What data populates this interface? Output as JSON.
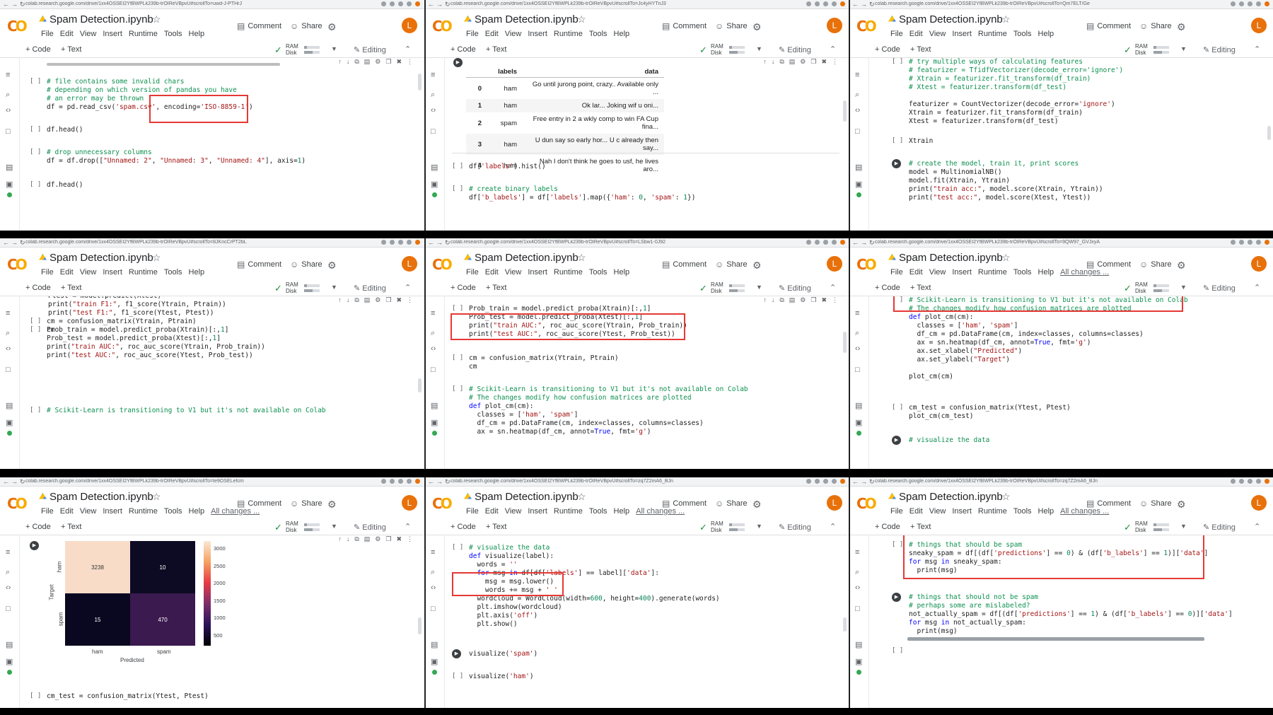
{
  "common": {
    "notebook_title": "Spam Detection.ipynb",
    "menu": [
      "File",
      "Edit",
      "View",
      "Insert",
      "Runtime",
      "Tools",
      "Help"
    ],
    "all_changes": "All changes ...",
    "comment": "Comment",
    "share": "Share",
    "avatar_letter": "L",
    "add_code": "+ Code",
    "add_text": "+ Text",
    "ram": "RAM",
    "disk": "Disk",
    "editing": "Editing",
    "empty_bracket": "[ ]",
    "colors": {
      "accent_orange": "#e8710a",
      "logo_yellow": "#f9ab00",
      "highlight_red": "#e53935",
      "ok_green": "#34a853"
    }
  },
  "panels": [
    {
      "url": "colab.research.google.com/drive/1xx4OSSEI2YfBWPLk239b-trOIReVBpvU#scrollTo=uwd-J-PTHrJ",
      "show_all_changes": false,
      "code": [
        "# file contains some invalid chars\n# depending on which version of pandas you have\n# an error may be thrown\ndf = pd.read_csv('spam.csv', encoding='ISO-8859-1')",
        "df.head()",
        "# drop unnecessary columns\ndf = df.drop([\"Unnamed: 2\", \"Unnamed: 3\", \"Unnamed: 4\"], axis=1)",
        "df.head()"
      ]
    },
    {
      "url": "colab.research.google.com/drive/1xx4OSSEI2YfBWPLk239b-trOIReVBpvU#scrollTo=Jc4yHYTnJ3",
      "show_all_changes": false,
      "table": {
        "columns": [
          "",
          "labels",
          "data"
        ],
        "rows": [
          [
            "0",
            "ham",
            "Go until jurong point, crazy.. Available only ..."
          ],
          [
            "1",
            "ham",
            "Ok lar... Joking wif u oni..."
          ],
          [
            "2",
            "spam",
            "Free entry in 2 a wkly comp to win FA Cup fina..."
          ],
          [
            "3",
            "ham",
            "U dun say so early hor... U c already then say..."
          ],
          [
            "4",
            "ham",
            "Nah I don't think he goes to usf, he lives aro..."
          ]
        ]
      },
      "code": [
        "df['labels'].hist()",
        "# create binary labels\ndf['b_labels'] = df['labels'].map({'ham': 0, 'spam': 1})"
      ]
    },
    {
      "url": "colab.research.google.com/drive/1xx4OSSEI2YfBWPLk239b-trOIReVBpvU#scrollTo=Qm7ELT/Ge",
      "show_all_changes": false,
      "code": [
        "# try multiple ways of calculating features\n# featurizer = TfidfVectorizer(decode_error='ignore')\n# Xtrain = featurizer.fit_transform(df_train)\n# Xtest = featurizer.transform(df_test)\n\nfeaturizer = CountVectorizer(decode_error='ignore')\nXtrain = featurizer.fit_transform(df_train)\nXtest = featurizer.transform(df_test)",
        "Xtrain",
        "# create the model, train it, print scores\nmodel = MultinomialNB()\nmodel.fit(Xtrain, Ytrain)\nprint(\"train acc:\", model.score(Xtrain, Ytrain))\nprint(\"test acc:\", model.score(Xtest, Ytest))"
      ]
    },
    {
      "url": "colab.research.google.com/drive/1xx4OSSEI2YfBWPLk239b-trOIReVBpvU#scrollTo=8JKncCrPT2bL",
      "show_all_changes": false,
      "code": [
        "Ptrain = model.predict(Xtrain)\nPtest = model.predict(Xtest)\nprint(\"train F1:\", f1_score(Ytrain, Ptrain))\nprint(\"test F1:\", f1_score(Ytest, Ptest))",
        "Prob_train = model.predict_proba(Xtrain)[:,1]\nProb_test = model.predict_proba(Xtest)[:,1]\nprint(\"train AUC:\", roc_auc_score(Ytrain, Prob_train))\nprint(\"test AUC:\", roc_auc_score(Ytest, Prob_test))",
        "cm = confusion_matrix(Ytrain, Ptrain)\ncm",
        "# Scikit-Learn is transitioning to V1 but it's not available on Colab"
      ]
    },
    {
      "url": "colab.research.google.com/drive/1xx4OSSEI2YfBWPLk239b-trOIReVBpvU#scrollTo=LSbw1-0J92",
      "show_all_changes": false,
      "code": [
        "Prob_train = model.predict_proba(Xtrain)[:,1]\nProb_test = model.predict_proba(Xtest)[:,1]\nprint(\"train AUC:\", roc_auc_score(Ytrain, Prob_train))\nprint(\"test AUC:\", roc_auc_score(Ytest, Prob_test))",
        "cm = confusion_matrix(Ytrain, Ptrain)\ncm",
        "# Scikit-Learn is transitioning to V1 but it's not available on Colab\n# The changes modify how confusion matrices are plotted\ndef plot_cm(cm):\n  classes = ['ham', 'spam']\n  df_cm = pd.DataFrame(cm, index=classes, columns=classes)\n  ax = sn.heatmap(df_cm, annot=True, fmt='g')"
      ]
    },
    {
      "url": "colab.research.google.com/drive/1xx4OSSEI2YfBWPLk239b-trOIReVBpvU#scrollTo=9QW97_GVJxyA",
      "show_all_changes": true,
      "code": [
        "# Scikit-Learn is transitioning to V1 but it's not available on Colab\n# The changes modify how confusion matrices are plotted\ndef plot_cm(cm):\n  classes = ['ham', 'spam']\n  df_cm = pd.DataFrame(cm, index=classes, columns=classes)\n  ax = sn.heatmap(df_cm, annot=True, fmt='g')\n  ax.set_xlabel(\"Predicted\")\n  ax.set_ylabel(\"Target\")\n\nplot_cm(cm)",
        "cm_test = confusion_matrix(Ytest, Ptest)\nplot_cm(cm_test)",
        "# visualize the data"
      ]
    },
    {
      "url": "colab.research.google.com/drive/1xx4OSSEI2YfBWPLk239b-trOIReVBpvU#scrollTo=te9OSELefcm",
      "show_all_changes": true,
      "heatmap": {
        "ylabel": "Target",
        "xlabel": "Predicted",
        "classes": [
          "ham",
          "spam"
        ],
        "values": [
          [
            "3238",
            "10"
          ],
          [
            "15",
            "470"
          ]
        ],
        "colorbar_ticks": [
          "3000",
          "2500",
          "2000",
          "1500",
          "1000",
          "500"
        ]
      },
      "code": [
        "cm_test = confusion_matrix(Ytest, Ptest)"
      ]
    },
    {
      "url": "colab.research.google.com/drive/1xx4OSSEI2YfBWPLk239b-trOIReVBpvU#scrollTo=zq7Z2mA6_BJn",
      "show_all_changes": true,
      "code": [
        "# visualize the data\ndef visualize(label):\n  words = ''\n  for msg in df[df['labels'] == label]['data']:\n    msg = msg.lower()\n    words += msg + ' '\n  wordcloud = WordCloud(width=600, height=400).generate(words)\n  plt.imshow(wordcloud)\n  plt.axis('off')\n  plt.show()",
        "visualize('spam')",
        "visualize('ham')"
      ]
    },
    {
      "url": "colab.research.google.com/drive/1xx4OSSEI2YfBWPLk239b-trOIReVBpvU#scrollTo=zq7Z2mA6_BJn",
      "show_all_changes": true,
      "code": [
        "# things that should be spam\nsneaky_spam = df[(df['predictions'] == 0) & (df['b_labels'] == 1)]['data']\nfor msg in sneaky_spam:\n  print(msg)",
        "# things that should not be spam\n# perhaps some are mislabeled?\nnot_actually_spam = df[(df['predictions'] == 1) & (df['b_labels'] == 0)]['data']\nfor msg in not_actually_spam:\n  print(msg)",
        ""
      ]
    }
  ]
}
